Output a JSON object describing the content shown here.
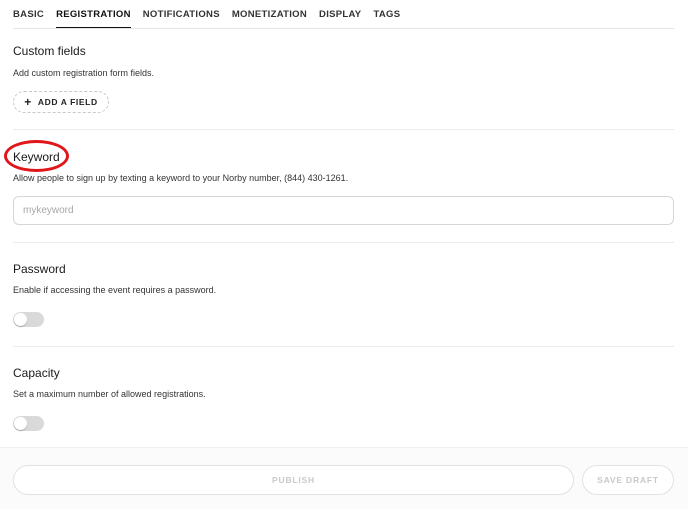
{
  "tabs": [
    {
      "label": "BASIC"
    },
    {
      "label": "REGISTRATION"
    },
    {
      "label": "NOTIFICATIONS"
    },
    {
      "label": "MONETIZATION"
    },
    {
      "label": "DISPLAY"
    },
    {
      "label": "TAGS"
    }
  ],
  "active_tab": "REGISTRATION",
  "custom_fields": {
    "title": "Custom fields",
    "description": "Add custom registration form fields.",
    "add_button_label": "ADD A FIELD",
    "add_button_icon": "plus-icon"
  },
  "keyword": {
    "title": "Keyword",
    "description": "Allow people to sign up by texting a keyword to your Norby number, (844) 430-1261.",
    "input_value": "",
    "input_placeholder": "mykeyword",
    "highlight_color": "#e0161b"
  },
  "password": {
    "title": "Password",
    "description": "Enable if accessing the event requires a password.",
    "enabled": false
  },
  "capacity": {
    "title": "Capacity",
    "description": "Set a maximum number of allowed registrations.",
    "enabled": false
  },
  "footer": {
    "publish_label": "PUBLISH",
    "save_draft_label": "SAVE DRAFT"
  }
}
